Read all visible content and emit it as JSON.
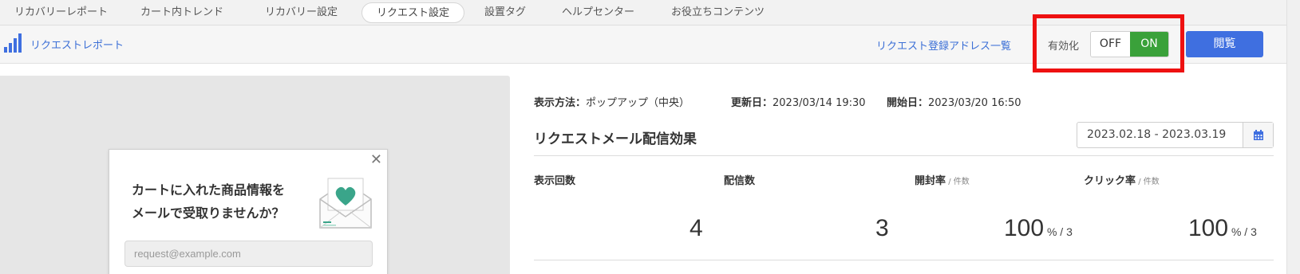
{
  "tabs": [
    {
      "label": "リカバリーレポート",
      "active": false
    },
    {
      "label": "カート内トレンド",
      "active": false
    },
    {
      "label": "リカバリー設定",
      "active": false
    },
    {
      "label": "リクエスト設定",
      "active": true
    },
    {
      "label": "設置タグ",
      "active": false
    },
    {
      "label": "ヘルプセンター",
      "active": false
    },
    {
      "label": "お役立ちコンテンツ",
      "active": false
    }
  ],
  "subheader": {
    "report_link": "リクエストレポート",
    "address_link": "リクエスト登録アドレス一覧",
    "enable_label": "有効化",
    "toggle_off": "OFF",
    "toggle_on": "ON",
    "toggle_state": "on",
    "view_button": "閲覧"
  },
  "popup": {
    "heading_line1": "カートに入れた商品情報を",
    "heading_line2": "メールで受取りませんか？",
    "email_placeholder": "request@example.com",
    "close_glyph": "✕"
  },
  "meta": {
    "display_method_label": "表示方法：",
    "display_method_value": "ポップアップ（中央）",
    "updated_label": "更新日：",
    "updated_value": "2023/03/14 19:30",
    "start_label": "開始日：",
    "start_value": "2023/03/20 16:50"
  },
  "effect": {
    "title": "リクエストメール配信効果",
    "date_range": "2023.02.18 - 2023.03.19",
    "stats": [
      {
        "label": "表示回数",
        "unit": "",
        "value": "4",
        "sub": ""
      },
      {
        "label": "配信数",
        "unit": "",
        "value": "3",
        "sub": ""
      },
      {
        "label": "開封率",
        "unit": " / 件数",
        "value": "100",
        "sub": " % / 3"
      },
      {
        "label": "クリック率",
        "unit": " / 件数",
        "value": "100",
        "sub": " % / 3"
      }
    ]
  },
  "colors": {
    "accent_blue": "#3f6fe0",
    "link_blue": "#3b6fd6",
    "toggle_on_green": "#3aa13a",
    "highlight_red": "#ee1111",
    "envelope_heart": "#3aa58a"
  },
  "icons": {
    "report": "bar-chart-icon",
    "calendar": "calendar-icon",
    "envelope": "envelope-heart-icon",
    "close": "close-icon"
  }
}
